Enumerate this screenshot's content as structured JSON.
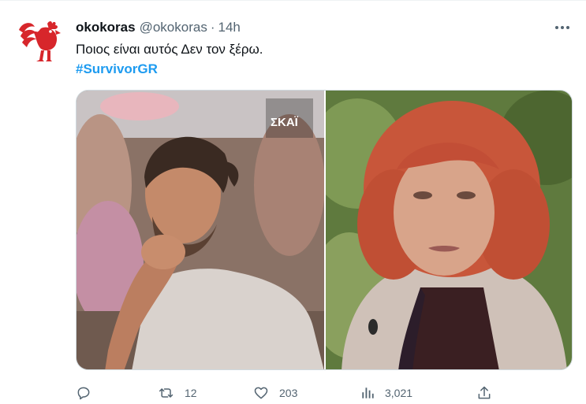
{
  "tweet": {
    "author": {
      "display_name": "okokoras",
      "handle": "@okokoras",
      "avatar_icon": "red-rooster-logo",
      "avatar_color": "#d7262b"
    },
    "separator": "·",
    "time": "14h",
    "text": "Ποιος είναι αυτός Δεν τον ξέρω.",
    "hashtag": "#SurvivorGR",
    "media": {
      "images": [
        {
          "type": "photo",
          "watermark": "ΣΚΑΪ"
        },
        {
          "type": "photo"
        }
      ]
    },
    "actions": {
      "reply": {
        "icon": "reply-icon",
        "count": ""
      },
      "retweet": {
        "icon": "retweet-icon",
        "count": "12"
      },
      "like": {
        "icon": "heart-icon",
        "count": "203"
      },
      "views": {
        "icon": "views-icon",
        "count": "3,021"
      },
      "share": {
        "icon": "share-icon"
      }
    },
    "more_icon": "more-options-icon"
  },
  "colors": {
    "text": "#0f1419",
    "muted": "#536471",
    "link": "#1d9bf0",
    "brand": "#d7262b",
    "divider": "#eff3f4"
  }
}
